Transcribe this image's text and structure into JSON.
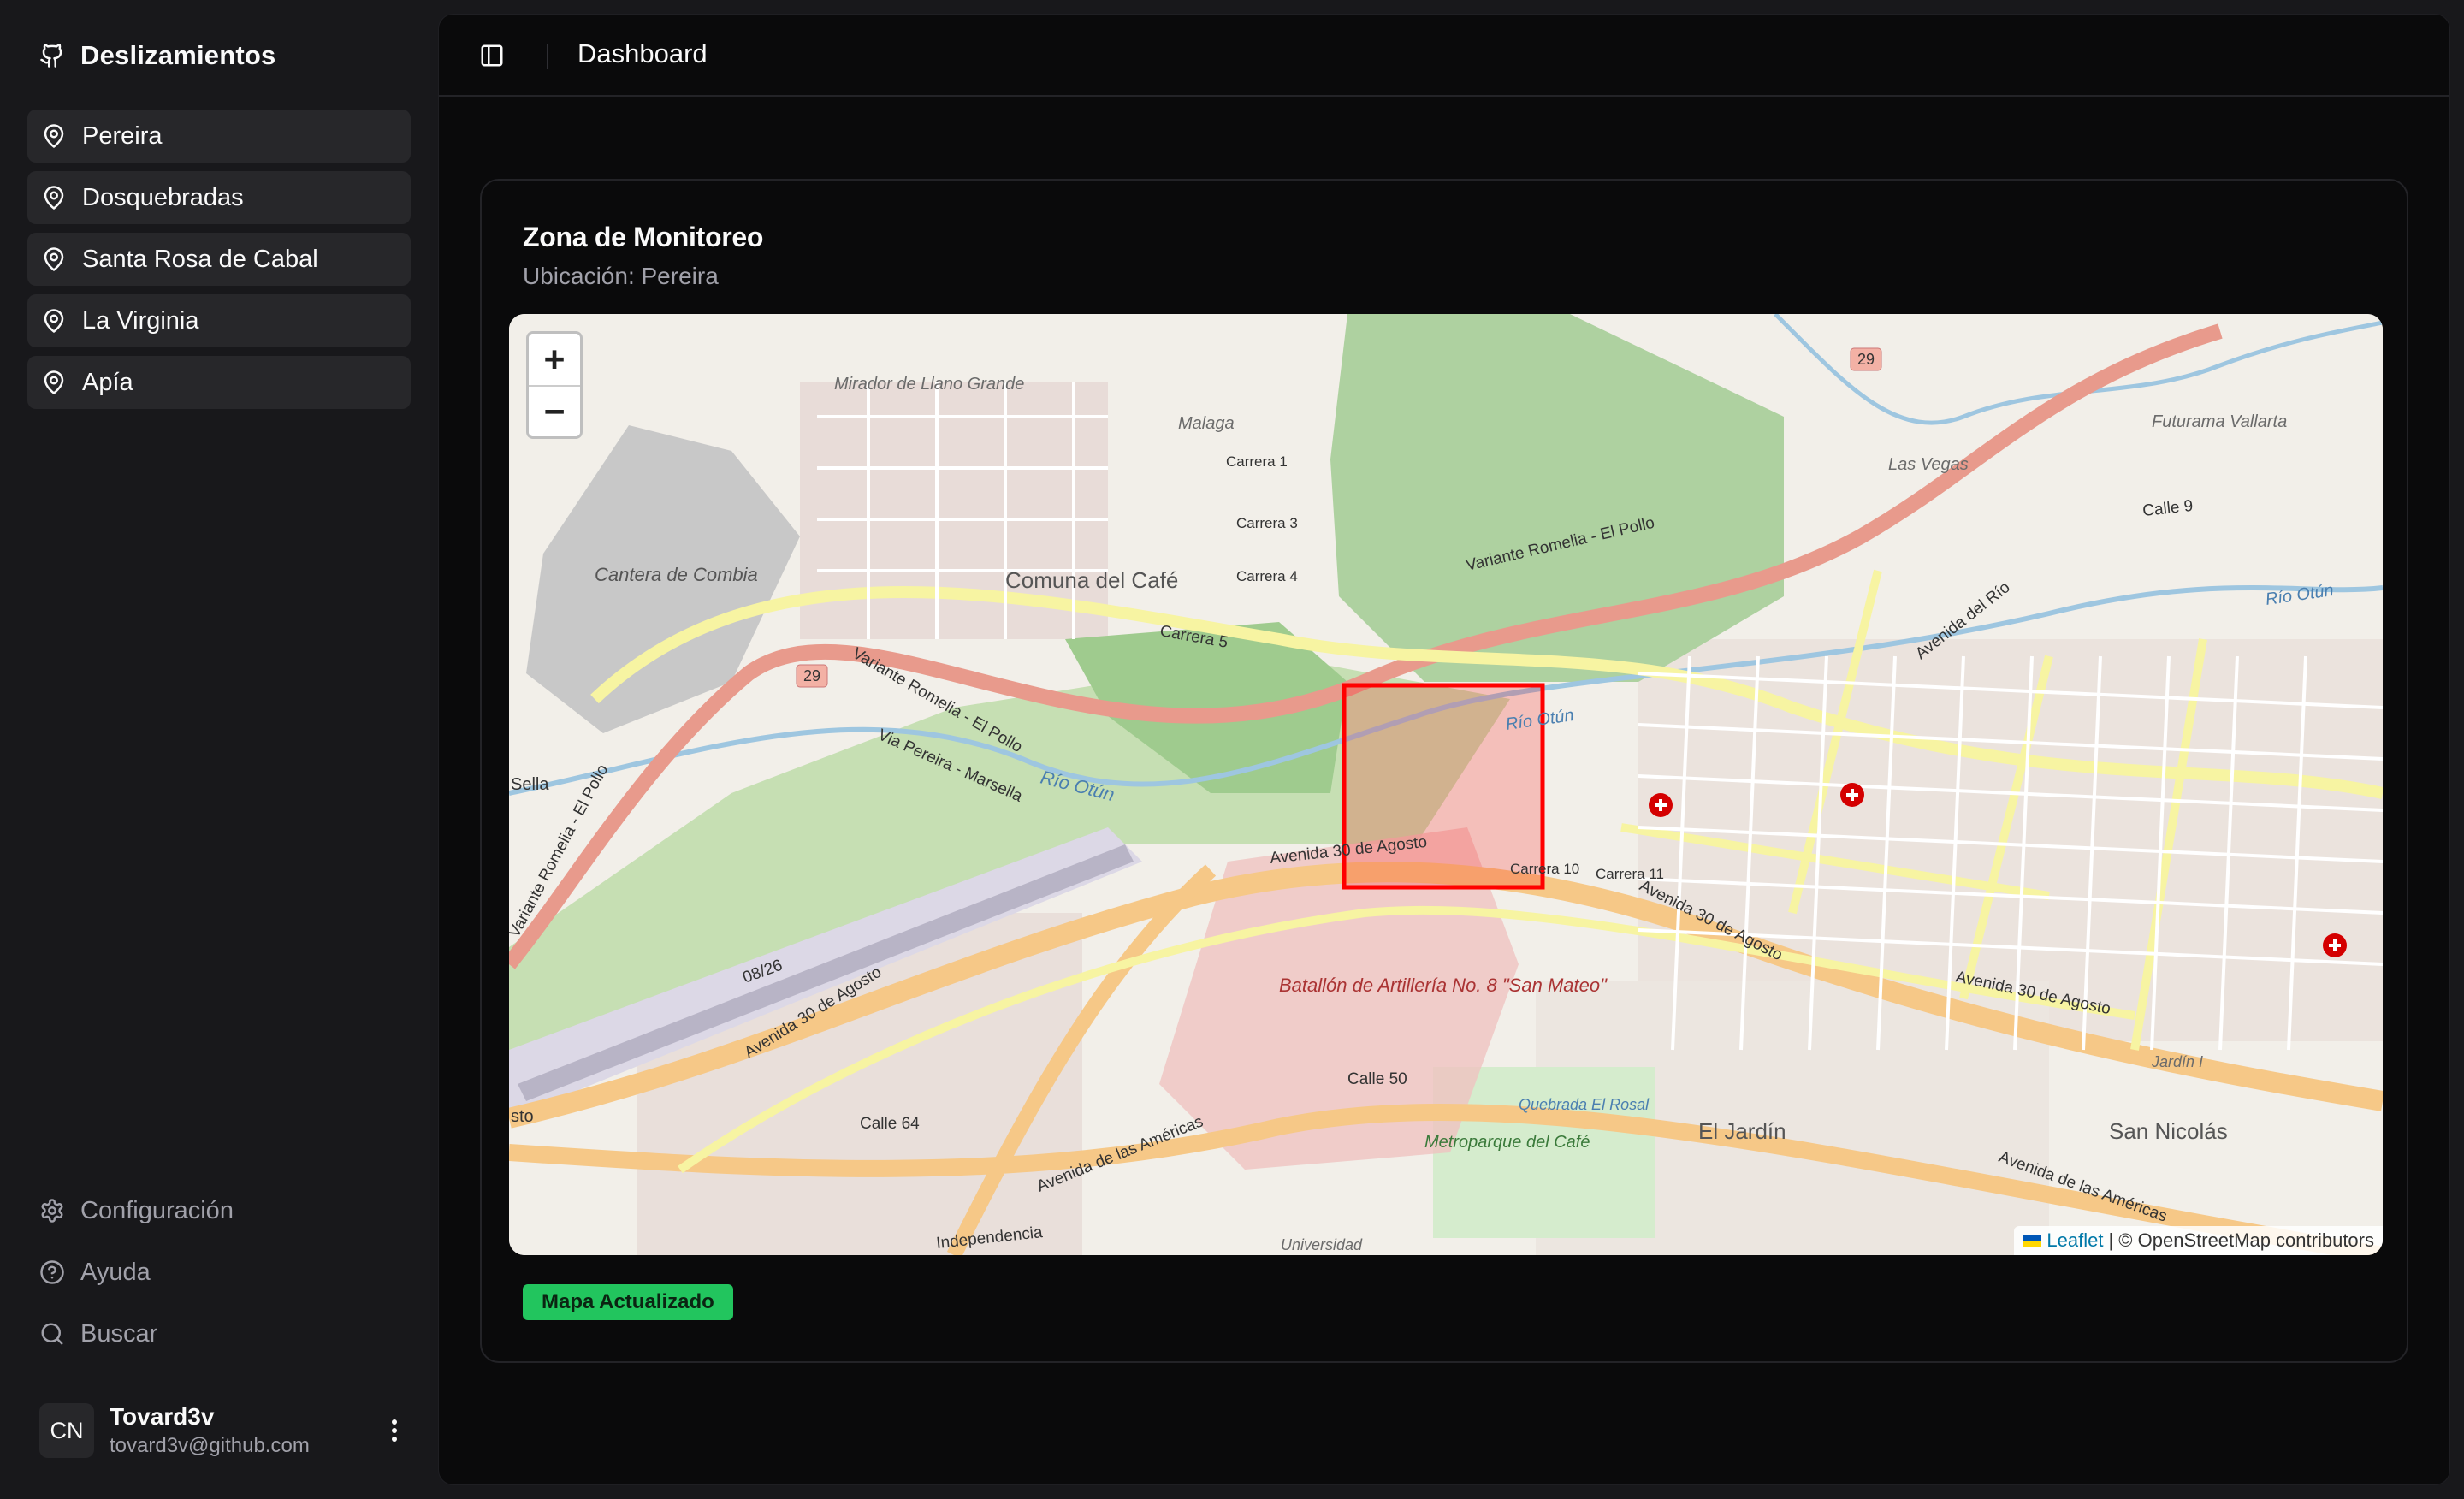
{
  "sidebar": {
    "brand": {
      "title": "Deslizamientos",
      "icon": "github-icon"
    },
    "nav_items": [
      {
        "label": "Pereira",
        "icon": "map-pin-icon"
      },
      {
        "label": "Dosquebradas",
        "icon": "map-pin-icon"
      },
      {
        "label": "Santa Rosa de Cabal",
        "icon": "map-pin-icon"
      },
      {
        "label": "La Virginia",
        "icon": "map-pin-icon"
      },
      {
        "label": "Apía",
        "icon": "map-pin-icon"
      }
    ],
    "secondary_items": [
      {
        "label": "Configuración",
        "icon": "gear-icon"
      },
      {
        "label": "Ayuda",
        "icon": "help-circle-icon"
      },
      {
        "label": "Buscar",
        "icon": "search-icon"
      }
    ],
    "user": {
      "initials": "CN",
      "name": "Tovard3v",
      "email": "tovard3v@github.com",
      "menu_icon": "more-vertical-icon"
    }
  },
  "header": {
    "toggle_icon": "sidebar-toggle-icon",
    "title": "Dashboard"
  },
  "card": {
    "title": "Zona de Monitoreo",
    "subtitle": "Ubicación: Pereira"
  },
  "map": {
    "zoom_in": "+",
    "zoom_out": "−",
    "attribution_link": "Leaflet",
    "attribution_text": "| © OpenStreetMap contributors",
    "highlight_color": "#ff0000",
    "labels": {
      "mirador": "Mirador de Llano Grande",
      "malaga": "Malaga",
      "cantera": "Cantera de Combia",
      "comuna": "Comuna del Café",
      "variante1": "Variante Romelia - El Pollo",
      "variante2": "Variante Romelia - El Pollo",
      "variante3": "Variante Romelia - El Pollo",
      "carrera5": "Carrera 5",
      "via_pereira": "Via Pereira - Marsella",
      "rio_otun1": "Río Otún",
      "rio_otun2": "Río Otún",
      "rio_otun3": "Río Otún",
      "av30_1": "Avenida 30 de Agosto",
      "av30_2": "Avenida 30 de Agosto",
      "av30_3": "Avenida 30 de Agosto",
      "av30_4": "Avenida 30 de Agosto",
      "batallon": "Batallón de Artillería No. 8 \"San Mateo\"",
      "metroparque": "Metroparque del Café",
      "el_jardin": "El Jardín",
      "san_nicolas": "San Nicolás",
      "las_vegas": "Las Vegas",
      "futurama": "Futurama Vallarta",
      "av_rio": "Avenida del Río",
      "av_americas": "Avenida de las Américas",
      "av_americas2": "Avenida de las Américas",
      "calle9": "Calle 9",
      "calle64": "Calle 64",
      "calle50": "Calle 50",
      "universidad": "Universidad",
      "independencia": "Independencia",
      "route29a": "29",
      "route29b": "29",
      "runway": "08/26",
      "carrera1": "Carrera 1",
      "carrera3": "Carrera 3",
      "carrera4": "Carrera 4",
      "carrera10": "Carrera 10",
      "carrera11": "Carrera 11",
      "quebrada": "Quebrada El Rosal",
      "jardin1": "Jardín I",
      "sella": "Sella",
      "sto": "sto"
    }
  },
  "status_badge": "Mapa Actualizado"
}
